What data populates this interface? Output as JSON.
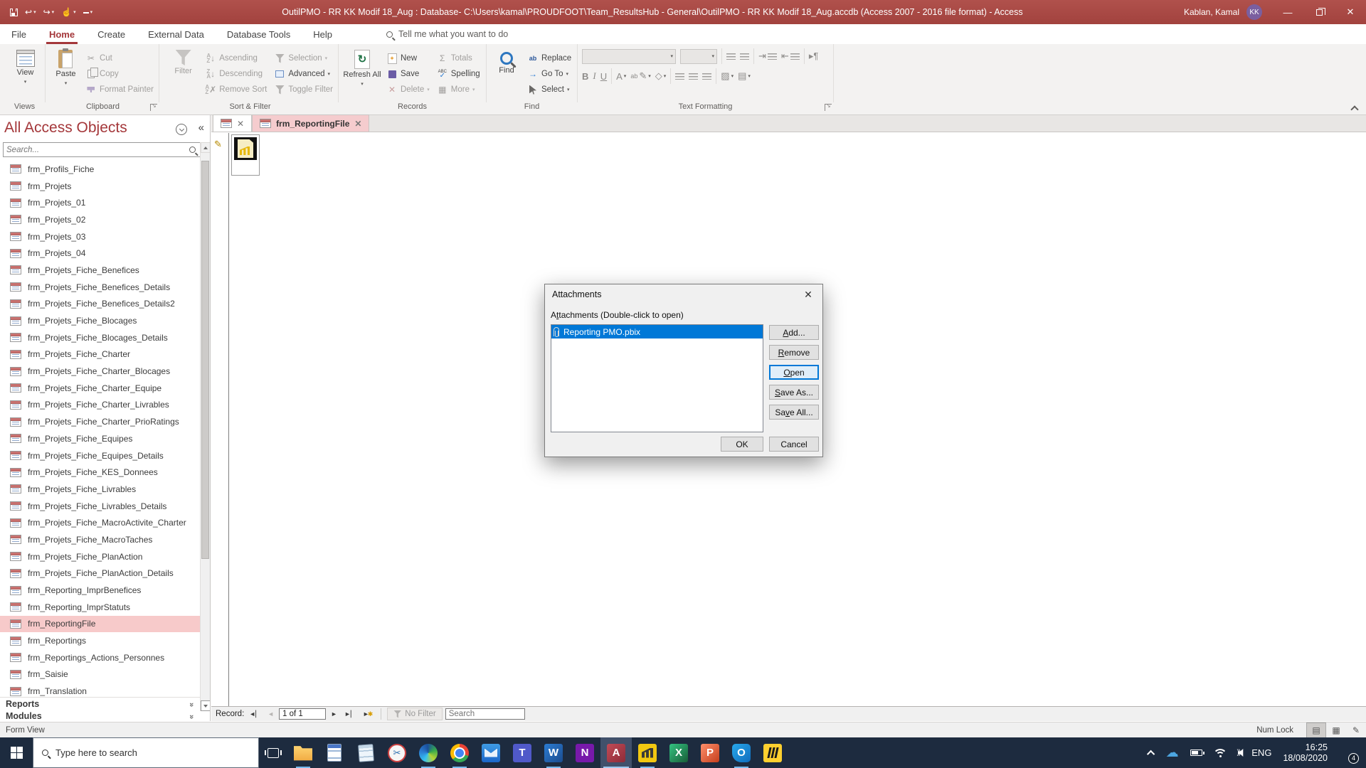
{
  "colors": {
    "accent": "#a4373a",
    "titlebar": "#a84946",
    "selection_blue": "#0078d7",
    "nav_selected": "#f7caca",
    "taskbar": "#1d2b3f"
  },
  "titlebar": {
    "title": "OutilPMO - RR KK Modif 18_Aug : Database- C:\\Users\\kamal\\PROUDFOOT\\Team_ResultsHub - General\\OutilPMO - RR KK Modif 18_Aug.accdb (Access 2007 - 2016 file format)  -  Access",
    "user_name": "Kablan, Kamal",
    "user_initials": "KK"
  },
  "ribbon": {
    "tabs": [
      {
        "label": "File"
      },
      {
        "label": "Home",
        "active": true
      },
      {
        "label": "Create"
      },
      {
        "label": "External Data"
      },
      {
        "label": "Database Tools"
      },
      {
        "label": "Help"
      }
    ],
    "tell_me": "Tell me what you want to do",
    "views": {
      "label": "Views",
      "view": "View"
    },
    "clipboard": {
      "label": "Clipboard",
      "paste": "Paste",
      "cut": "Cut",
      "copy": "Copy",
      "format_painter": "Format Painter"
    },
    "sort_filter": {
      "label": "Sort & Filter",
      "filter": "Filter",
      "ascending": "Ascending",
      "descending": "Descending",
      "remove_sort": "Remove Sort",
      "selection": "Selection",
      "advanced": "Advanced",
      "toggle_filter": "Toggle Filter"
    },
    "records": {
      "label": "Records",
      "refresh_all": "Refresh All",
      "new": "New",
      "save": "Save",
      "delete": "Delete",
      "totals": "Totals",
      "spelling": "Spelling",
      "more": "More"
    },
    "find": {
      "label": "Find",
      "find": "Find",
      "replace": "Replace",
      "go_to": "Go To",
      "select": "Select"
    },
    "text_formatting": {
      "label": "Text Formatting",
      "bold": "B",
      "italic": "I",
      "underline": "U"
    }
  },
  "nav_pane": {
    "title": "All Access Objects",
    "search_placeholder": "Search...",
    "items": [
      {
        "label": "frm_Profils_Fiche"
      },
      {
        "label": "frm_Projets"
      },
      {
        "label": "frm_Projets_01"
      },
      {
        "label": "frm_Projets_02"
      },
      {
        "label": "frm_Projets_03"
      },
      {
        "label": "frm_Projets_04"
      },
      {
        "label": "frm_Projets_Fiche_Benefices"
      },
      {
        "label": "frm_Projets_Fiche_Benefices_Details"
      },
      {
        "label": "frm_Projets_Fiche_Benefices_Details2"
      },
      {
        "label": "frm_Projets_Fiche_Blocages"
      },
      {
        "label": "frm_Projets_Fiche_Blocages_Details"
      },
      {
        "label": "frm_Projets_Fiche_Charter"
      },
      {
        "label": "frm_Projets_Fiche_Charter_Blocages"
      },
      {
        "label": "frm_Projets_Fiche_Charter_Equipe"
      },
      {
        "label": "frm_Projets_Fiche_Charter_Livrables"
      },
      {
        "label": "frm_Projets_Fiche_Charter_PrioRatings"
      },
      {
        "label": "frm_Projets_Fiche_Equipes"
      },
      {
        "label": "frm_Projets_Fiche_Equipes_Details"
      },
      {
        "label": "frm_Projets_Fiche_KES_Donnees"
      },
      {
        "label": "frm_Projets_Fiche_Livrables"
      },
      {
        "label": "frm_Projets_Fiche_Livrables_Details"
      },
      {
        "label": "frm_Projets_Fiche_MacroActivite_Charter"
      },
      {
        "label": "frm_Projets_Fiche_MacroTaches"
      },
      {
        "label": "frm_Projets_Fiche_PlanAction"
      },
      {
        "label": "frm_Projets_Fiche_PlanAction_Details"
      },
      {
        "label": "frm_Reporting_ImprBenefices"
      },
      {
        "label": "frm_Reporting_ImprStatuts"
      },
      {
        "label": "frm_ReportingFile",
        "selected": true
      },
      {
        "label": "frm_Reportings"
      },
      {
        "label": "frm_Reportings_Actions_Personnes"
      },
      {
        "label": "frm_Saisie"
      },
      {
        "label": "frm_Translation"
      }
    ],
    "sections": [
      {
        "label": "Reports"
      },
      {
        "label": "Modules"
      }
    ]
  },
  "document": {
    "tab_label": "frm_ReportingFile"
  },
  "dialog": {
    "title": "Attachments",
    "instruction": {
      "pre": "A",
      "accel": "t",
      "rest": "tachments (Double-click to open)"
    },
    "attachment_name": "Reporting PMO.pbix",
    "buttons": [
      {
        "pre": "",
        "accel": "A",
        "rest": "dd..."
      },
      {
        "pre": "",
        "accel": "R",
        "rest": "emove"
      },
      {
        "pre": "",
        "accel": "O",
        "rest": "pen",
        "default": true
      },
      {
        "pre": "",
        "accel": "S",
        "rest": "ave As..."
      },
      {
        "pre": "Sa",
        "accel": "v",
        "rest": "e All..."
      }
    ],
    "ok_label": "OK",
    "cancel_label": "Cancel"
  },
  "record_nav": {
    "label": "Record:",
    "position": "1 of 1",
    "no_filter": "No Filter",
    "search_placeholder": "Search"
  },
  "status_bar": {
    "left": "Form View",
    "num_lock": "Num Lock"
  },
  "taskbar": {
    "search_placeholder": "Type here to search",
    "apps": [
      {
        "name": "file-explorer",
        "open": true
      },
      {
        "name": "wordpad"
      },
      {
        "name": "notepad"
      },
      {
        "name": "snipping-tool",
        "letter": "✂"
      },
      {
        "name": "edge",
        "open": true
      },
      {
        "name": "chrome",
        "open": true
      },
      {
        "name": "mail"
      },
      {
        "name": "teams",
        "letter": "T"
      },
      {
        "name": "word",
        "letter": "W",
        "open": true
      },
      {
        "name": "onenote",
        "letter": "N"
      },
      {
        "name": "access",
        "letter": "A",
        "open": true,
        "active": true
      },
      {
        "name": "power-bi",
        "open": true
      },
      {
        "name": "excel",
        "letter": "X"
      },
      {
        "name": "powerpoint",
        "letter": "P"
      },
      {
        "name": "outlook",
        "letter": "O",
        "open": true
      },
      {
        "name": "miro"
      }
    ],
    "tray": {
      "language": "ENG",
      "time": "16:25",
      "date": "18/08/2020",
      "notification_count": "4"
    }
  }
}
